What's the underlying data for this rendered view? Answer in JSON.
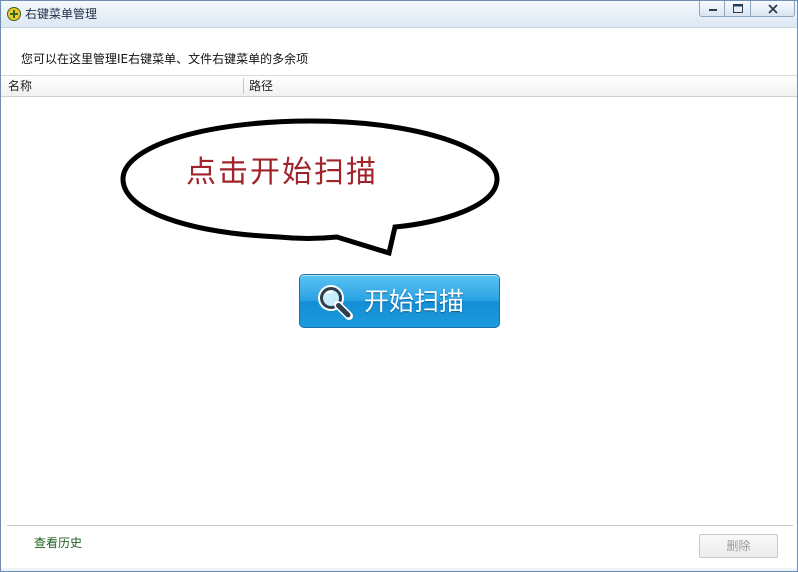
{
  "window": {
    "title": "右键菜单管理",
    "controls": {
      "minimize": "minimize",
      "maximize": "maximize",
      "close": "close"
    }
  },
  "info": {
    "text": "您可以在这里管理IE右键菜单、文件右键菜单的多余项"
  },
  "table": {
    "columns": [
      "名称",
      "路径"
    ],
    "rows": []
  },
  "callout": {
    "text": "点击开始扫描"
  },
  "scan_button": {
    "label": "开始扫描",
    "icon": "magnifier-icon"
  },
  "footer": {
    "history_link": "查看历史",
    "delete_button": "删除"
  },
  "colors": {
    "titlebar": "#dde8f3",
    "callout_text": "#a1232b",
    "scan_button": "#1c99dc",
    "history_link": "#1c5f1c",
    "disabled_text": "#9a9a9a"
  }
}
